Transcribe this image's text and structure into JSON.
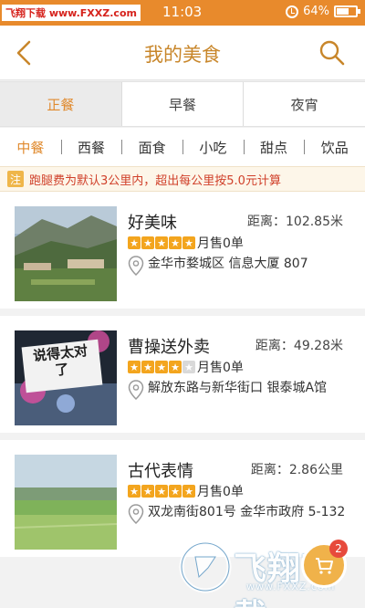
{
  "status_bar": {
    "watermark": "飞翔下载 www.FXXZ.com",
    "time": "11:03",
    "battery": "64%",
    "battery_level": 0.64
  },
  "header": {
    "back_icon": "chevron-left-icon",
    "title": "我的美食",
    "search_icon": "search-icon"
  },
  "meal_tabs": [
    {
      "label": "正餐",
      "active": true
    },
    {
      "label": "早餐",
      "active": false
    },
    {
      "label": "夜宵",
      "active": false
    }
  ],
  "cuisines": [
    {
      "label": "中餐",
      "active": true
    },
    {
      "label": "西餐",
      "active": false
    },
    {
      "label": "面食",
      "active": false
    },
    {
      "label": "小吃",
      "active": false
    },
    {
      "label": "甜点",
      "active": false
    },
    {
      "label": "饮品",
      "active": false
    }
  ],
  "notice": {
    "tag": "注",
    "text": "跑腿费为默认3公里内，超出每公里按5.0元计算"
  },
  "shops": [
    {
      "name": "好美味",
      "distance": "距离：102.85米",
      "rating": 5,
      "sales": "月售0单",
      "address": "金华市婺城区 信息大厦 807"
    },
    {
      "name": "曹操送外卖",
      "distance": "距离：49.28米",
      "rating": 4,
      "sales": "月售0单",
      "address": "解放东路与新华街口 银泰城A馆",
      "thumb_text": "说得太对了"
    },
    {
      "name": "古代表情",
      "distance": "距离：2.86公里",
      "rating": 5,
      "sales": "月售0单",
      "address": "双龙南街801号 金华市政府 5-132"
    }
  ],
  "fab": {
    "count": "2"
  },
  "watermark": {
    "logo_text": "飞翔下载",
    "url": "www.FXXZ.com"
  },
  "colors": {
    "accent": "#e08a2e",
    "status_bar": "#e88a2c",
    "notice_text": "#d0402a",
    "star": "#f3a51e"
  }
}
